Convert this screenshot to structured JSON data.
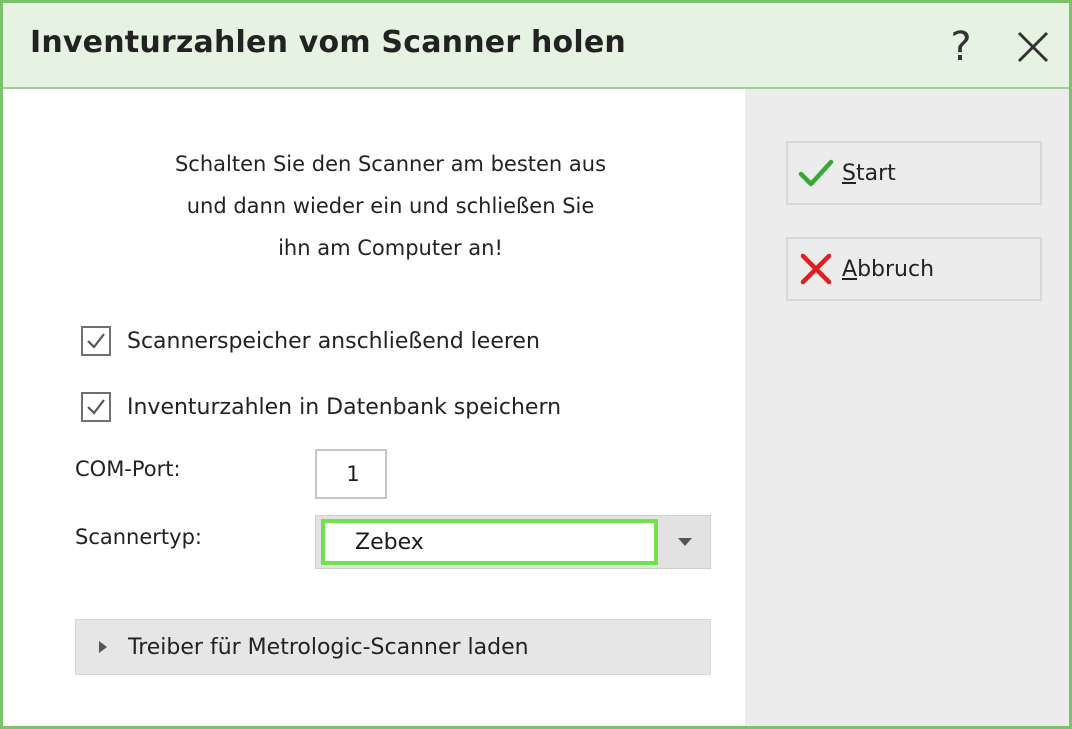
{
  "window": {
    "title": "Inventurzahlen vom Scanner holen",
    "help_glyph": "?",
    "close_icon": "close-icon"
  },
  "instructions": {
    "line1": "Schalten Sie den Scanner am besten aus",
    "line2": "und dann wieder ein und schließen Sie",
    "line3": "ihn am Computer an!"
  },
  "options": [
    {
      "label": "Scannerspeicher anschließend leeren",
      "checked": true
    },
    {
      "label": "Inventurzahlen in Datenbank speichern",
      "checked": true
    }
  ],
  "com_port": {
    "label": "COM-Port:",
    "value": "1"
  },
  "scanner_type": {
    "label": "Scannertyp:",
    "selected": "Zebex"
  },
  "driver_expander": {
    "label": "Treiber für Metrologic-Scanner laden",
    "expanded": false
  },
  "buttons": {
    "start": {
      "mnemonic": "S",
      "rest": "tart",
      "icon": "checkmark-icon"
    },
    "cancel": {
      "mnemonic": "A",
      "rest": "bbruch",
      "icon": "x-icon"
    }
  },
  "colors": {
    "title_bar": "#e7f3e2",
    "window_border": "#7ec16b",
    "focus_ring": "#6fe34b",
    "check_green": "#3aa63a",
    "cancel_red": "#e02020"
  }
}
